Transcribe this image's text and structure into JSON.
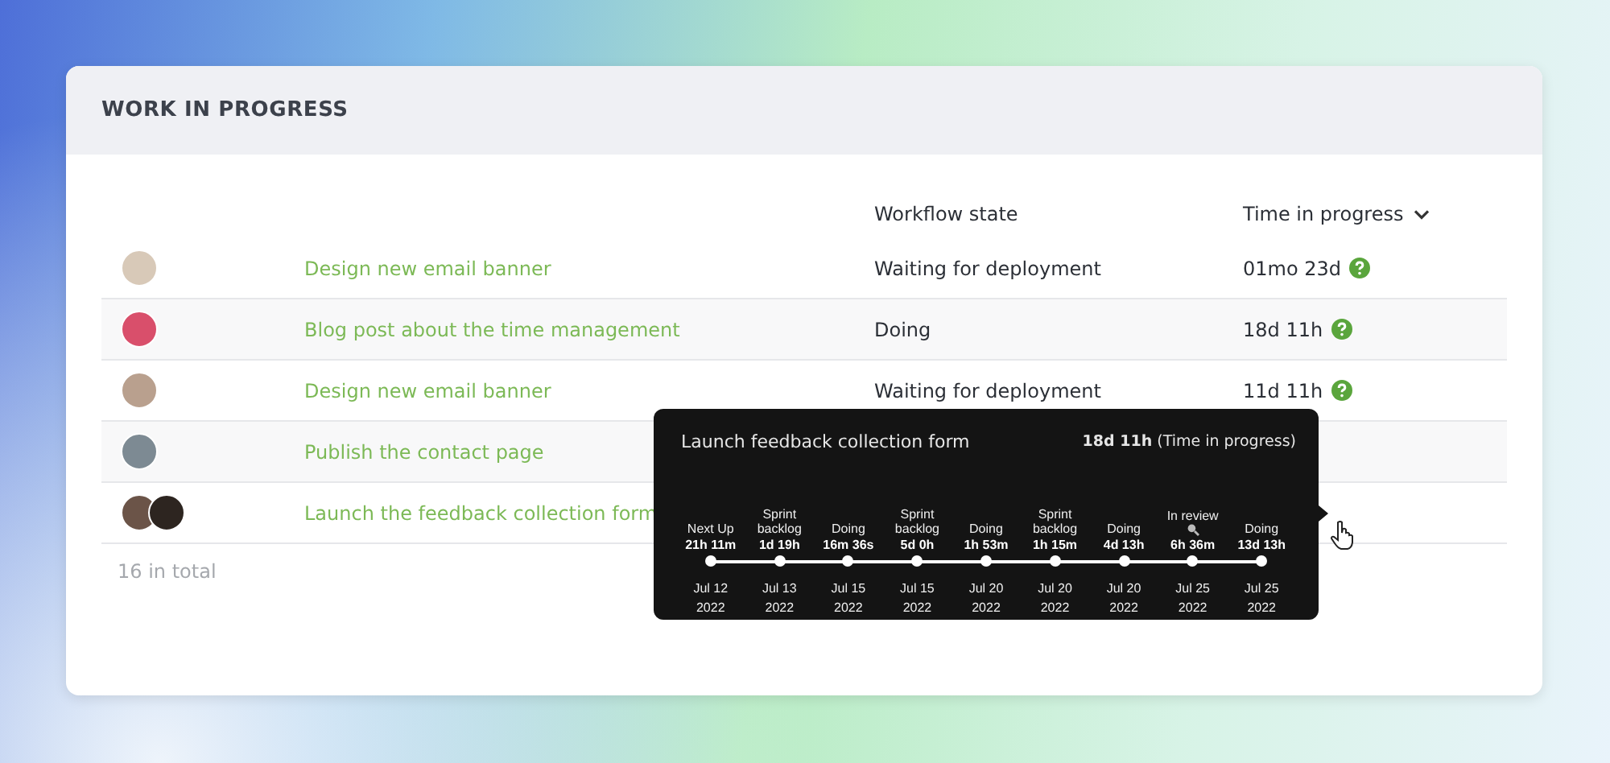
{
  "card": {
    "title": "WORK IN PROGRESS"
  },
  "table": {
    "columns": [
      "Workflow state",
      "Time in progress"
    ],
    "rows": [
      {
        "avatars": [
          {
            "kind": "photo"
          }
        ],
        "task": "Design new email banner",
        "state": "Waiting for deployment",
        "time": "01mo 23d"
      },
      {
        "avatars": [
          {
            "kind": "photo"
          }
        ],
        "task": "Blog post about the time management",
        "state": "Doing",
        "time": "18d 11h"
      },
      {
        "avatars": [
          {
            "kind": "photo"
          }
        ],
        "task": "Design new email banner",
        "state": "Waiting for deployment",
        "time": "11d 11h"
      },
      {
        "avatars": [
          {
            "kind": "photo"
          }
        ],
        "task": "Publish the contact page"
      },
      {
        "avatars": [
          {
            "kind": "photo"
          },
          {
            "kind": "photo"
          }
        ],
        "task": "Launch the feedback collection form"
      }
    ],
    "total": "16 in total"
  },
  "tooltip": {
    "title": "Launch feedback collection form",
    "total": "18d 11h",
    "total_label": "(Time in progress)",
    "steps": [
      {
        "kind": "plain",
        "state": "Next Up",
        "duration": "21h 11m",
        "date": "Jul 12",
        "year": "2022"
      },
      {
        "kind": "plain",
        "state": "Sprint backlog",
        "duration": "1d 19h",
        "date": "Jul 13",
        "year": "2022"
      },
      {
        "kind": "plain",
        "state": "Doing",
        "duration": "16m 36s",
        "date": "Jul 15",
        "year": "2022"
      },
      {
        "kind": "plain",
        "state": "Sprint backlog",
        "duration": "5d 0h",
        "date": "Jul 15",
        "year": "2022"
      },
      {
        "kind": "plain",
        "state": "Doing",
        "duration": "1h 53m",
        "date": "Jul 20",
        "year": "2022"
      },
      {
        "kind": "plain",
        "state": "Sprint backlog",
        "duration": "1h 15m",
        "date": "Jul 20",
        "year": "2022"
      },
      {
        "kind": "plain",
        "state": "Doing",
        "duration": "4d 13h",
        "date": "Jul 20",
        "year": "2022"
      },
      {
        "kind": "marked",
        "state": "In review",
        "duration": "6h 36m",
        "date": "Jul 25",
        "year": "2022"
      },
      {
        "kind": "plain",
        "state": "Doing",
        "duration": "13d 13h",
        "date": "Jul 25",
        "year": "2022"
      }
    ]
  }
}
